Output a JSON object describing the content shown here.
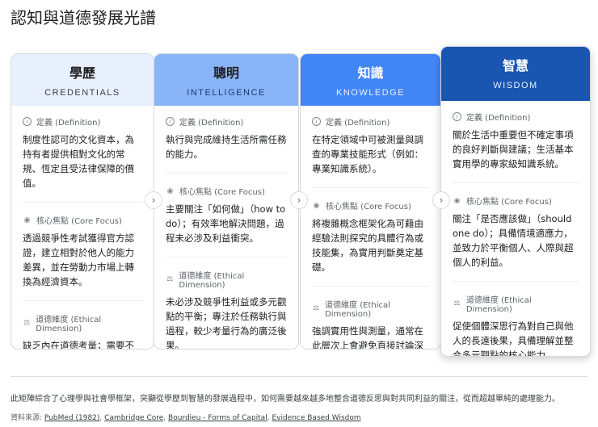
{
  "title": "認知與道德發展光譜",
  "labels": {
    "definition": "定義 (Definition)",
    "core_focus": "核心焦點 (Core Focus)",
    "ethical": "道德維度 (Ethical Dimension)"
  },
  "cards": [
    {
      "zh": "學歷",
      "en": "CREDENTIALS",
      "definition": "制度性認可的文化資本，為持有者提供相對文化的常規、恆定且受法律保障的價值。",
      "core_focus": "透過競爭性考試獲得官方認證，建立相對於他人的能力差異，並在勞動力市場上轉換為經濟資本。",
      "ethical": "缺乏內在道德考量；需要不斷證明自身價值，主要用於衡量相對的社會地位與貨幣價值。",
      "color": "#e8f0fe"
    },
    {
      "zh": "聰明",
      "en": "INTELLIGENCE",
      "definition": "執行與完成維持生活所需任務的能力。",
      "core_focus": "主要關注「如何做」（how to do）；有效率地解決問題，過程未必涉及利益衝突。",
      "ethical": "未必涉及競爭性利益或多元觀點的平衡；專注於任務執行與過程，較少考量行為的廣泛後果。",
      "color": "#8ab4f8"
    },
    {
      "zh": "知識",
      "en": "KNOWLEDGE",
      "definition": "在特定領域中可被測量與調查的專業技能形式（例如：專業知識系統）。",
      "core_focus": "將複雜概念框架化為可藉由經驗法則探究的具體行為或技能集，為實用判斷奠定基礎。",
      "ethical": "強調實用性與測量，通常在此層次上會避免直接討論深層次的情感與動機。",
      "color": "#4285f4"
    },
    {
      "zh": "智慧",
      "en": "WISDOM",
      "definition": "關於生活中重要但不確定事項的良好判斷與建議；生活基本實用學的專家級知識系統。",
      "core_focus": "關注「是否應該做」（should one do）；具備情境適應力，並致力於平衡個人、人際與超個人的利益。",
      "ethical": "促使個體深思行為對自己與他人的長遠後果，具備理解並整合多元觀點的核心能力。",
      "color": "#1a56b0"
    }
  ],
  "footer": "此矩陣綜合了心理學與社會學框架，突顯從學歷到智慧的發展過程中，如何需要越來越多地整合道德反思與對共同利益的關注，從而超越單純的處理能力。",
  "sources_label": "資料來源:",
  "sources": [
    "PubMed (1982)",
    "Cambridge Core",
    "Bourdieu - Forms of Capital",
    "Evidence Based Wisdom"
  ]
}
